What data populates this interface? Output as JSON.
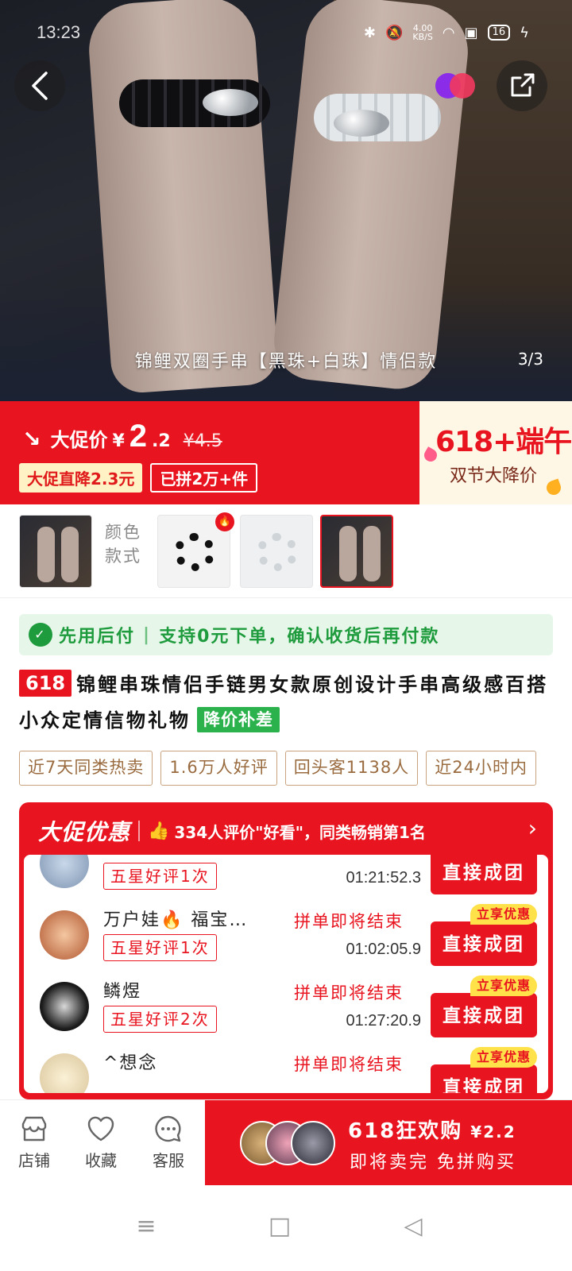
{
  "status": {
    "time": "13:23",
    "net_speed_value": "4.00",
    "net_speed_unit": "KB/S",
    "battery": "16"
  },
  "hero": {
    "caption": "锦鲤双圈手串【黑珠+白珠】情侣款",
    "counter": "3/3"
  },
  "price": {
    "label": "大促价",
    "currency": "¥",
    "integer": "2",
    "decimal": ".2",
    "original": "¥4.5",
    "chip_discount": "大促直降2.3元",
    "chip_sold": "已拼2万+件"
  },
  "festival": {
    "headline": "618+端午",
    "subline": "双节大降价"
  },
  "variants": {
    "label": "颜色款式",
    "hot_badge": "🔥"
  },
  "paylater": {
    "title": "先用后付",
    "separator": "|",
    "desc": "支持0元下单，确认收货后再付款"
  },
  "product": {
    "tag_618": "618",
    "title": "锦鲤串珠情侣手链男女款原创设计手串高级感百搭小众定情信物礼物",
    "tag_price": "降价补差"
  },
  "highlights": [
    "近7天同类热卖",
    "1.6万人好评",
    "回头客1138人",
    "近24小时内"
  ],
  "promo": {
    "title": "大促优惠",
    "desc": "334人评价\"好看\"，同类畅销第1名",
    "groups": [
      {
        "name": "",
        "badge": "五星好评1次",
        "status": "",
        "timer": "01:21:52.3",
        "button": "直接成团",
        "pill": ""
      },
      {
        "name": "万户娃🔥 福宝…",
        "badge": "五星好评1次",
        "status": "拼单即将结束",
        "timer": "01:02:05.9",
        "button": "直接成团",
        "pill": "立享优惠"
      },
      {
        "name": "鳞煜",
        "badge": "五星好评2次",
        "status": "拼单即将结束",
        "timer": "01:27:20.9",
        "button": "直接成团",
        "pill": "立享优惠"
      },
      {
        "name": "^想念",
        "badge": "",
        "status": "拼单即将结束",
        "timer": "",
        "button": "直接成团",
        "pill": "立享优惠"
      }
    ]
  },
  "bottom": {
    "store": "店铺",
    "favorite": "收藏",
    "service": "客服",
    "buy_title": "618狂欢购",
    "buy_price": "¥2.2",
    "buy_sub": "即将卖完 免拼购买"
  },
  "colors": {
    "brand_red": "#e8141f",
    "green": "#1e9b3c",
    "gold": "#9a6b3f"
  }
}
